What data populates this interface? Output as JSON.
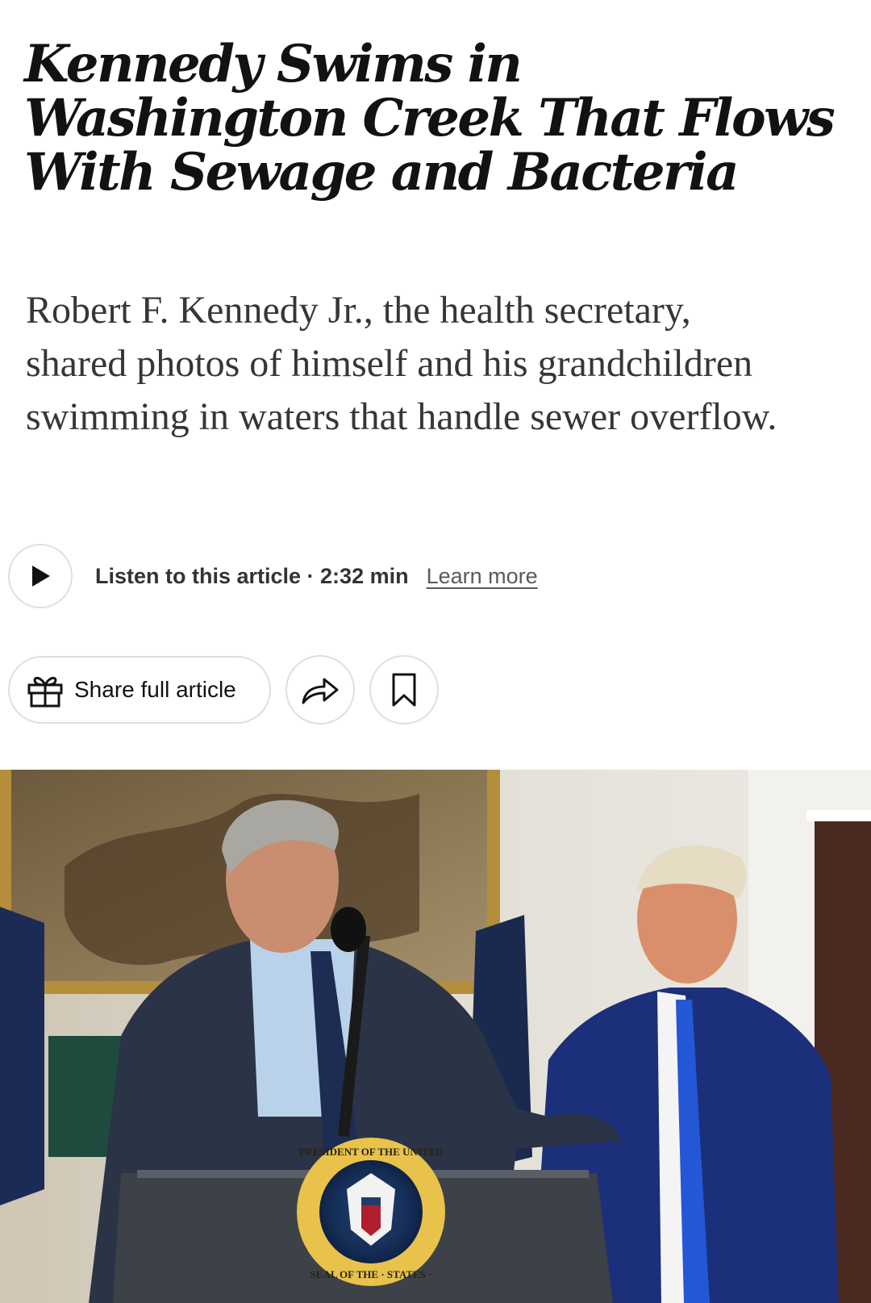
{
  "article": {
    "headline": "Kennedy Swims in Washington Creek That Flows With Sewage and Bacteria",
    "summary": "Robert F. Kennedy Jr., the health secretary, shared photos of himself and his grandchildren swimming in waters that handle sewer overflow."
  },
  "audio": {
    "listen_label": "Listen to this article · 2:32 min",
    "learn_more": "Learn more"
  },
  "actions": {
    "share_label": "Share full article",
    "icons": [
      "play-icon",
      "gift-icon",
      "share-arrow-icon",
      "bookmark-icon"
    ]
  },
  "photo": {
    "seal_text_top": "PRESIDENT OF THE UNITED",
    "seal_text_bottom": "SEAL OF THE · STATES ·"
  },
  "colors": {
    "text": "#121212",
    "summary_text": "#363636",
    "border": "#dfdfdf",
    "link": "#5a5a5a"
  }
}
